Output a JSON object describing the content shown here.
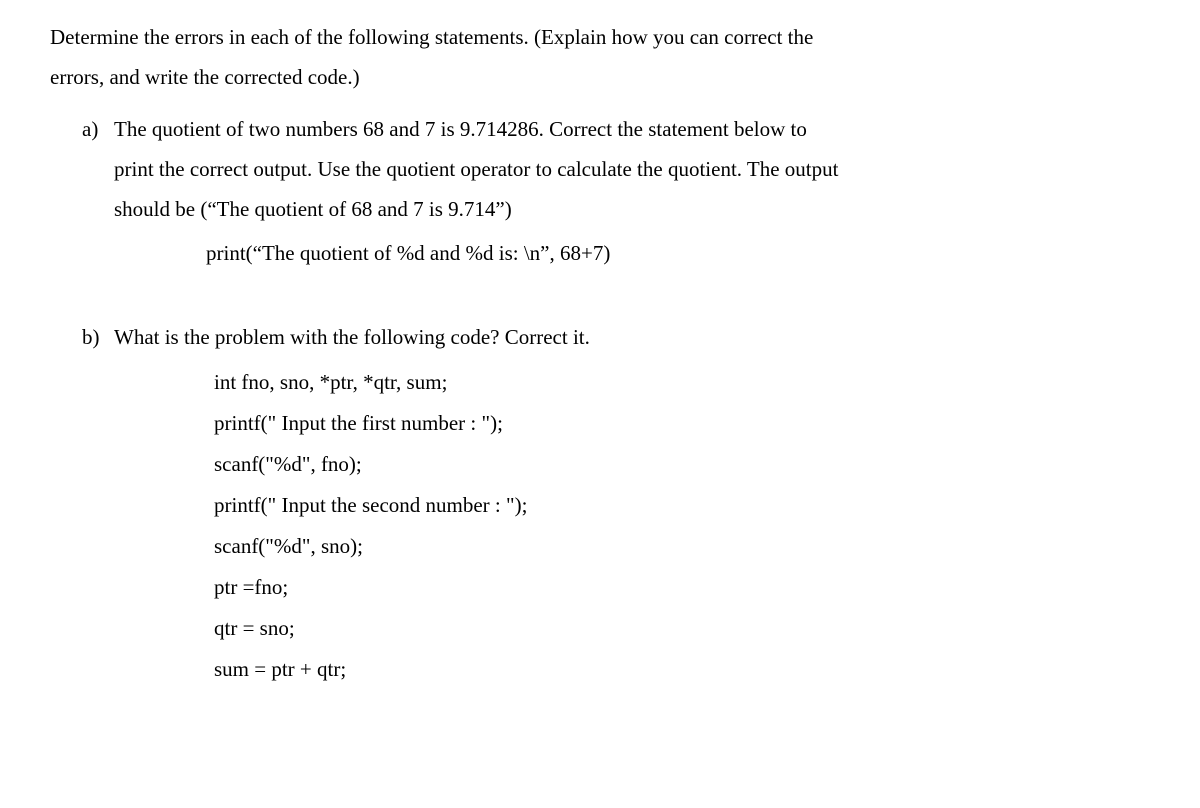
{
  "intro": {
    "line1": "Determine the errors in each of the following statements. (Explain how you can correct the",
    "line2": "errors, and write the corrected code.)"
  },
  "questionA": {
    "label": "a)",
    "line1": "The quotient of two numbers 68 and 7 is 9.714286. Correct the statement below to",
    "line2": "print the correct output. Use the quotient operator to calculate the quotient. The output",
    "line3": "should be (“The quotient of 68 and 7 is 9.714”)",
    "code": "print(“The quotient of %d and %d is: \\n”, 68+7)"
  },
  "questionB": {
    "label": "b)",
    "line1": "What is the problem with the following code? Correct it.",
    "code": [
      "int fno, sno, *ptr, *qtr, sum;",
      "printf(\" Input the first number : \");",
      "scanf(\"%d\", fno);",
      "printf(\" Input the second  number : \");",
      "scanf(\"%d\", sno);",
      "ptr =fno;",
      "qtr = sno;",
      "sum = ptr + qtr;"
    ]
  }
}
